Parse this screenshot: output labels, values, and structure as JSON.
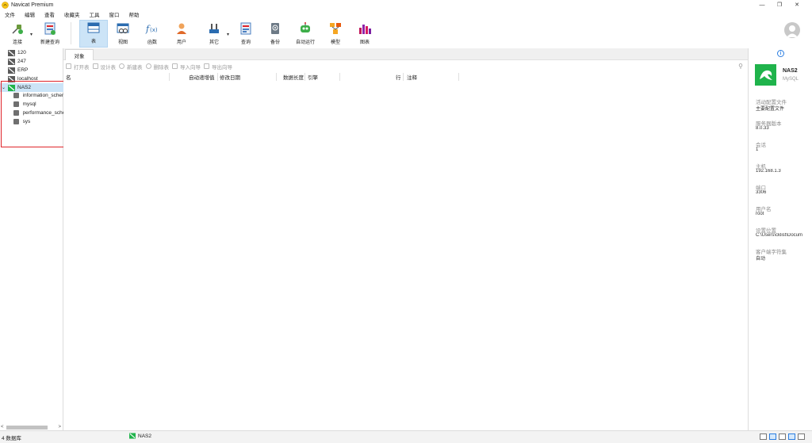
{
  "window": {
    "title": "Navicat Premium",
    "controls": {
      "minimize": "—",
      "maximize": "❐",
      "close": "✕"
    }
  },
  "menu": [
    "文件",
    "编辑",
    "查看",
    "收藏夹",
    "工具",
    "窗口",
    "帮助"
  ],
  "toolbar": {
    "connect": "连接",
    "new_query": "新建查询",
    "table": "表",
    "view": "视图",
    "function": "函数",
    "user": "用户",
    "other": "其它",
    "query": "查询",
    "backup": "备份",
    "automation": "自动运行",
    "model": "模型",
    "chart": "图表"
  },
  "sidebar": {
    "connections": [
      "120",
      "247",
      "ERP",
      "localhost"
    ],
    "active_connection": "NAS2",
    "databases": [
      "information_schema",
      "mysql",
      "performance_schema",
      "sys"
    ],
    "scroll_left": "<",
    "scroll_right": ">"
  },
  "main": {
    "tab": "对象",
    "actions": {
      "open_table": "打开表",
      "design_table": "设计表",
      "new_table": "新建表",
      "delete_table": "删除表",
      "import_wizard": "导入向导",
      "export_wizard": "导出向导"
    },
    "columns": {
      "name": "名",
      "auto_increment": "自动递增值",
      "modified": "修改日期",
      "data_length": "数据长度",
      "engine": "引擎",
      "rows": "行",
      "comment": "注释"
    }
  },
  "info_panel": {
    "name": "NAS2",
    "type": "MySQL",
    "fields": [
      {
        "label": "活动配置文件",
        "value": "主要配置文件"
      },
      {
        "label": "服务器版本",
        "value": "8.0.33"
      },
      {
        "label": "会话",
        "value": "1"
      },
      {
        "label": "主机",
        "value": "192.168.1.3"
      },
      {
        "label": "端口",
        "value": "3306"
      },
      {
        "label": "用户名",
        "value": "root"
      },
      {
        "label": "设置位置",
        "value": "C:\\Users\\cklist\\Docum"
      },
      {
        "label": "客户端字符集",
        "value": "自动"
      }
    ]
  },
  "status": {
    "count": "4 数据库",
    "connection": "NAS2"
  },
  "colors": {
    "accent": "#cce4f7",
    "mysql_green": "#1fb34b",
    "highlight_box": "#e0242a"
  }
}
